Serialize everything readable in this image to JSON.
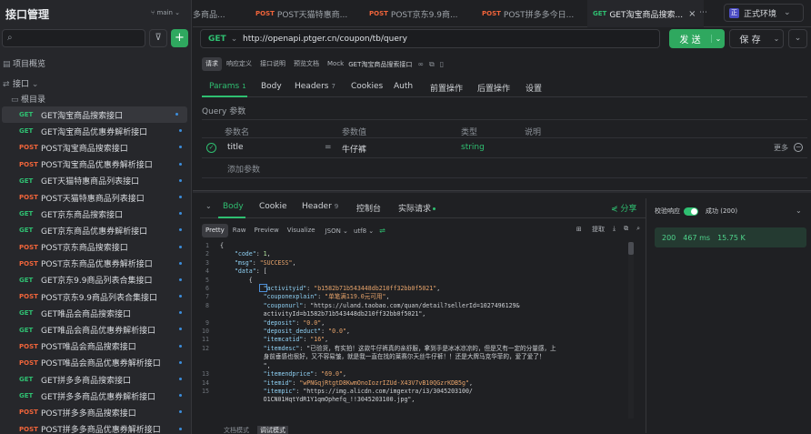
{
  "app": {
    "title": "接口管理",
    "branch": "main"
  },
  "tabs": [
    {
      "method": "",
      "label": "多商品..."
    },
    {
      "method": "POST",
      "label": "POST天猫特惠商..."
    },
    {
      "method": "POST",
      "label": "POST京东9.9商..."
    },
    {
      "method": "POST",
      "label": "POST拼多多今日..."
    },
    {
      "method": "GET",
      "label": "GET淘宝商品搜索..."
    }
  ],
  "env": {
    "label": "正式环境",
    "icon_text": "正"
  },
  "sidebar": {
    "overview": "项目概览",
    "api": "接口",
    "root": "根目录",
    "items": [
      {
        "method": "GET",
        "name": "GET淘宝商品搜索接口"
      },
      {
        "method": "GET",
        "name": "GET淘宝商品优惠券解析接口"
      },
      {
        "method": "POST",
        "name": "POST淘宝商品搜索接口"
      },
      {
        "method": "POST",
        "name": "POST淘宝商品优惠券解析接口"
      },
      {
        "method": "GET",
        "name": "GET天猫特惠商品列表接口"
      },
      {
        "method": "POST",
        "name": "POST天猫特惠商品列表接口"
      },
      {
        "method": "GET",
        "name": "GET京东商品搜索接口"
      },
      {
        "method": "GET",
        "name": "GET京东商品优惠券解析接口"
      },
      {
        "method": "POST",
        "name": "POST京东商品搜索接口"
      },
      {
        "method": "POST",
        "name": "POST京东商品优惠券解析接口"
      },
      {
        "method": "GET",
        "name": "GET京东9.9商品列表合集接口"
      },
      {
        "method": "POST",
        "name": "POST京东9.9商品列表合集接口"
      },
      {
        "method": "GET",
        "name": "GET唯品会商品搜索接口"
      },
      {
        "method": "GET",
        "name": "GET唯品会商品优惠券解析接口"
      },
      {
        "method": "POST",
        "name": "POST唯品会商品搜索接口"
      },
      {
        "method": "POST",
        "name": "POST唯品会商品优惠券解析接口"
      },
      {
        "method": "GET",
        "name": "GET拼多多商品搜索接口"
      },
      {
        "method": "GET",
        "name": "GET拼多多商品优惠券解析接口"
      },
      {
        "method": "POST",
        "name": "POST拼多多商品搜索接口"
      },
      {
        "method": "POST",
        "name": "POST拼多多商品优惠券解析接口"
      }
    ]
  },
  "request": {
    "method": "GET",
    "url": "http://openapi.ptger.cn/coupon/tb/query",
    "send": "发 送",
    "save": "保 存",
    "subtabs": [
      "请求",
      "响应定义",
      "接口说明",
      "预览文档",
      "Mock"
    ],
    "name": "GET淘宝商品搜索接口"
  },
  "param_tabs": [
    {
      "label": "Params",
      "count": "1"
    },
    {
      "label": "Body",
      "count": ""
    },
    {
      "label": "Headers",
      "count": "7"
    },
    {
      "label": "Cookies",
      "count": ""
    },
    {
      "label": "Auth",
      "count": ""
    },
    {
      "label": "前置操作",
      "count": ""
    },
    {
      "label": "后置操作",
      "count": ""
    },
    {
      "label": "设置",
      "count": ""
    }
  ],
  "query": {
    "section": "Query 参数",
    "headers": [
      "参数名",
      "参数值",
      "类型",
      "说明"
    ],
    "row": {
      "name": "title",
      "eq": "=",
      "value": "牛仔裤",
      "type": "string"
    },
    "more": "更多",
    "add": "添加参数"
  },
  "response": {
    "tabs": [
      {
        "label": "Body",
        "count": ""
      },
      {
        "label": "Cookie",
        "count": ""
      },
      {
        "label": "Header",
        "count": "9"
      },
      {
        "label": "控制台",
        "count": ""
      },
      {
        "label": "实际请求",
        "count": ""
      }
    ],
    "share": "分享",
    "views": [
      "Pretty",
      "Raw",
      "Preview",
      "Visualize"
    ],
    "format": "JSON ⌄",
    "encoding": "utf8 ⌄",
    "extract": "提取",
    "validate": "校验响应",
    "status_label": "成功 (200)",
    "status": {
      "code": "200",
      "time": "467 ms",
      "size": "15.75 K"
    },
    "bottom_tabs": [
      "文档模式",
      "调试模式"
    ],
    "lines": [
      {
        "n": "1",
        "t": "{"
      },
      {
        "n": "2",
        "t": "    \"code\": 1,"
      },
      {
        "n": "3",
        "t": "    \"msg\": \"SUCCESS\","
      },
      {
        "n": "4",
        "t": "    \"data\": ["
      },
      {
        "n": "5",
        "t": "        {"
      },
      {
        "n": "6",
        "t": "            \"activityid\": \"b1582b71b543448db210ff32bb0f5021\","
      },
      {
        "n": "7",
        "t": "            \"couponexplain\": \"单笔满119.0元可用\","
      },
      {
        "n": "8",
        "t": "            \"couponurl\": \"https://uland.taobao.com/quan/detail?sellerId=1027496129&"
      },
      {
        "n": "",
        "t": "            activityId=b1582b71b543448db210ff32bb0f5021\","
      },
      {
        "n": "9",
        "t": "            \"deposit\": \"0.0\","
      },
      {
        "n": "10",
        "t": "            \"deposit_deduct\": \"0.0\","
      },
      {
        "n": "11",
        "t": "            \"itemcatid\": \"16\","
      },
      {
        "n": "12",
        "t": "            \"itemdesc\": \"已验货，有实拍！这款牛仔裤真的亲舒服，拿到手是冰冰凉凉的，但是又有一定的分量感，上"
      },
      {
        "n": "",
        "t": "            身前垂感也很好，又不容易皱，就是我一直在找的莱赛尔天丝牛仔裤！！还是大牌马克华菲的，爱了爱了！"
      },
      {
        "n": "",
        "t": "            \","
      },
      {
        "n": "13",
        "t": "            \"itemendprice\": \"69.0\","
      },
      {
        "n": "14",
        "t": "            \"itemid\": \"wPNGqjRtgtD8KwmOnoIozrIZUd-X43V7vB10QGzrKDB5g\","
      },
      {
        "n": "15",
        "t": "            \"itempic\": \"https://img.alicdn.com/imgextra/i3/3045203100/"
      },
      {
        "n": "",
        "t": "            O1CN01HqtYdR1Y1qmOphefq_!!3045203100.jpg\","
      }
    ]
  }
}
